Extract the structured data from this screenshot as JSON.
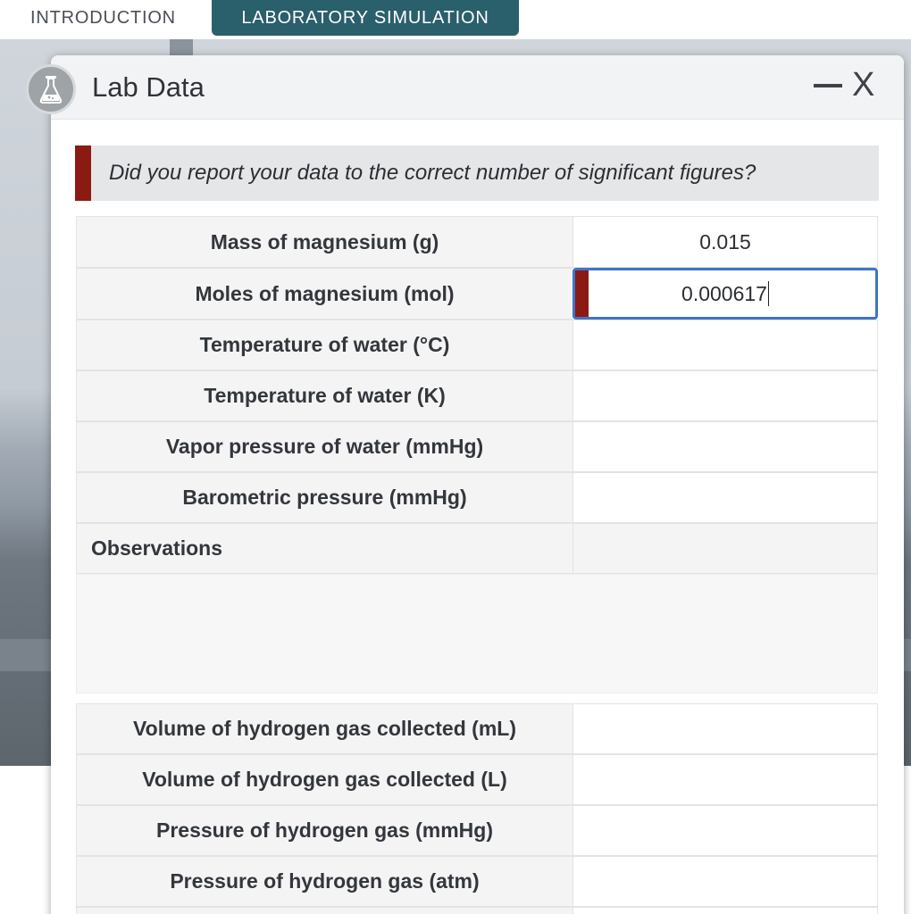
{
  "tabs": [
    {
      "label": "INTRODUCTION",
      "active": false
    },
    {
      "label": "LABORATORY SIMULATION",
      "active": true
    }
  ],
  "dialog": {
    "title": "Lab Data",
    "icon": "flask-icon",
    "minimize_icon": "minimize-icon",
    "close_label": "X"
  },
  "message": {
    "text": "Did you report your data to the correct number of significant figures?",
    "accent_color": "#8b1a12"
  },
  "rows_top": [
    {
      "label": "Mass of magnesium (g)",
      "value": "0.015"
    },
    {
      "label": "Moles of magnesium (mol)",
      "value": "0.000617",
      "active": true,
      "error": true
    },
    {
      "label": "Temperature of water (°C)",
      "value": ""
    },
    {
      "label": "Temperature of water (K)",
      "value": ""
    },
    {
      "label": "Vapor pressure of water (mmHg)",
      "value": ""
    },
    {
      "label": "Barometric pressure (mmHg)",
      "value": ""
    }
  ],
  "observations": {
    "label": "Observations",
    "value": ""
  },
  "rows_bottom": [
    {
      "label": "Volume of hydrogen gas collected (mL)",
      "value": ""
    },
    {
      "label": "Volume of hydrogen gas collected (L)",
      "value": ""
    },
    {
      "label": "Pressure of hydrogen gas (mmHg)",
      "value": ""
    },
    {
      "label": "Pressure of hydrogen gas (atm)",
      "value": ""
    }
  ],
  "colors": {
    "tab_active": "#2a5f6c",
    "focus_border": "#3f74c9",
    "error": "#8b1a12"
  }
}
